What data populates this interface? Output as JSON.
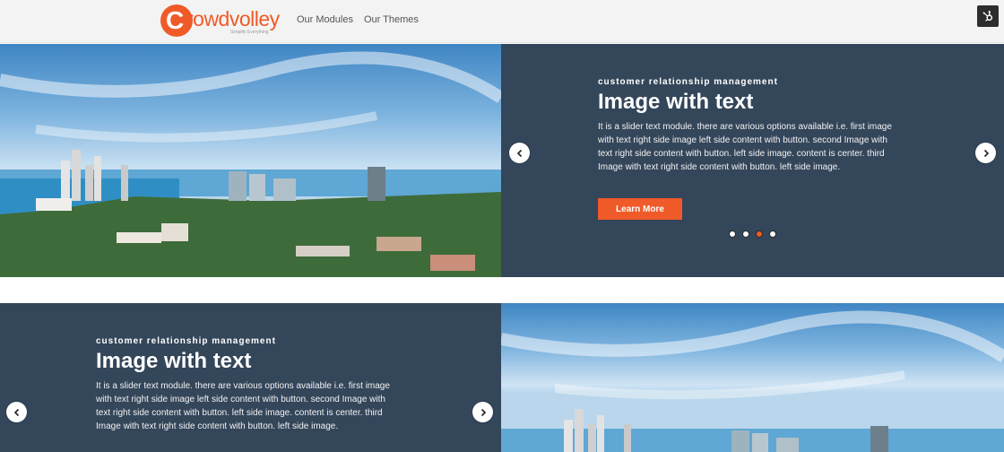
{
  "header": {
    "logo_letter": "C",
    "logo_text": "rowdvolley",
    "logo_tagline": "Simplify Everything",
    "nav": [
      {
        "label": "Our Modules"
      },
      {
        "label": "Our Themes"
      }
    ]
  },
  "slides": [
    {
      "kicker": "customer relationship management",
      "title": "Image with text",
      "body": "It is a slider text module. there are various options available i.e. first image with text right side image left side content with button. second Image with text right side content with button. left side image. content is center. third Image with text right side content with button. left side image.",
      "cta_label": "Learn More",
      "dots": [
        {
          "active": false
        },
        {
          "active": false
        },
        {
          "active": true
        },
        {
          "active": false
        }
      ]
    },
    {
      "kicker": "customer relationship management",
      "title": "Image with text",
      "body": "It is a slider text module. there are various options available i.e. first image with text right side image left side content with button. second Image with text right side content with button. left side image. content is center. third Image with text right side content with button. left side image."
    }
  ],
  "colors": {
    "accent": "#f05a28",
    "panel": "#34465a",
    "header_bg": "#f3f3f3"
  },
  "icons": {
    "prev": "chevron-left-icon",
    "next": "chevron-right-icon",
    "hub": "hubspot-icon"
  }
}
